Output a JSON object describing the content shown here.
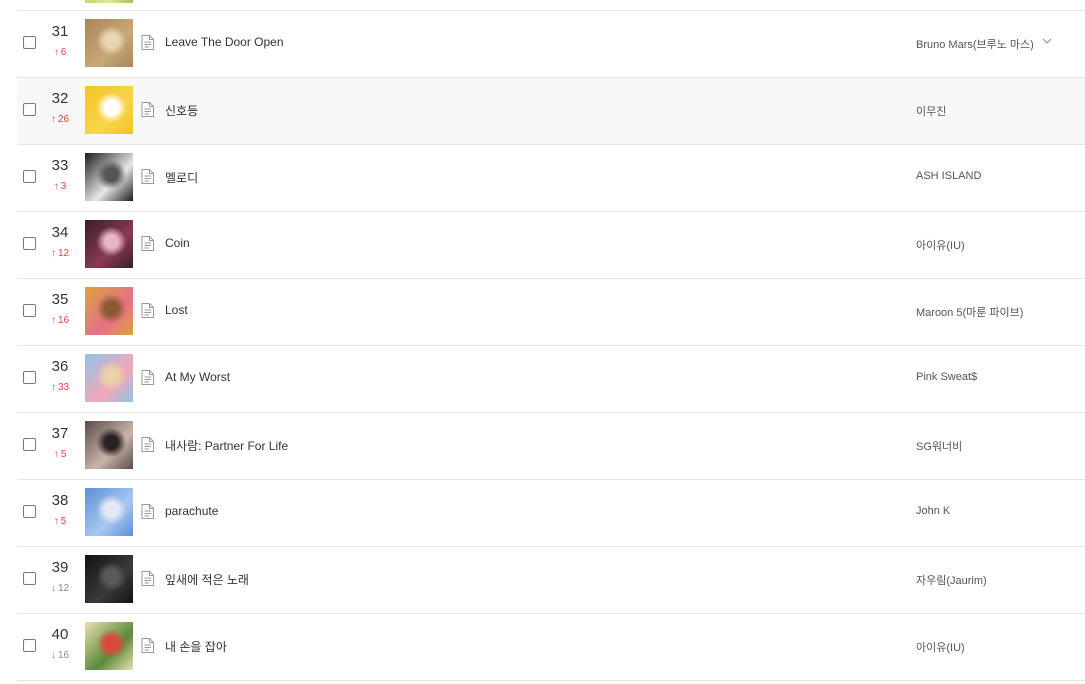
{
  "chart": {
    "rows": [
      {
        "rank": "31",
        "direction": "up",
        "change": "6",
        "title": "Leave The Door Open",
        "artist": "Bruno Mars(브루노 마스)",
        "art": [
          "#a98458",
          "#c9a877",
          "#e8d7b3"
        ],
        "has_menu": true,
        "highlighted": false
      },
      {
        "rank": "32",
        "direction": "up",
        "change": "26",
        "title": "신호등",
        "artist": "이무진",
        "art": [
          "#f2c326",
          "#f6d64a",
          "#ffffff"
        ],
        "has_menu": false,
        "highlighted": true
      },
      {
        "rank": "33",
        "direction": "up",
        "change": "3",
        "title": "멜로디",
        "artist": "ASH ISLAND",
        "art": [
          "#1b1b1b",
          "#e8e8e8",
          "#555555"
        ],
        "has_menu": false,
        "highlighted": false
      },
      {
        "rank": "34",
        "direction": "up",
        "change": "12",
        "title": "Coin",
        "artist": "아이유(IU)",
        "art": [
          "#3a1d2a",
          "#8a3a52",
          "#e6b6c2"
        ],
        "has_menu": false,
        "highlighted": false
      },
      {
        "rank": "35",
        "direction": "up",
        "change": "16",
        "title": "Lost",
        "artist": "Maroon 5(마룬 파이브)",
        "art": [
          "#d9a53a",
          "#e86e8a",
          "#8c5a32"
        ],
        "has_menu": false,
        "highlighted": false
      },
      {
        "rank": "36",
        "direction": "up",
        "change": "33",
        "title": "At My Worst",
        "artist": "Pink Sweat$",
        "art": [
          "#8fc4e8",
          "#f3a7b9",
          "#e9d1a8"
        ],
        "has_menu": false,
        "highlighted": false
      },
      {
        "rank": "37",
        "direction": "up",
        "change": "5",
        "title": "내사람: Partner For Life",
        "artist": "SG워너비",
        "art": [
          "#5a4a4a",
          "#c9b6a8",
          "#2a2222"
        ],
        "has_menu": false,
        "highlighted": false
      },
      {
        "rank": "38",
        "direction": "up",
        "change": "5",
        "title": "parachute",
        "artist": "John K",
        "art": [
          "#5c8fd6",
          "#a9c8ef",
          "#e3e9f7"
        ],
        "has_menu": false,
        "highlighted": false
      },
      {
        "rank": "39",
        "direction": "down",
        "change": "12",
        "title": "잎새에 적은 노래",
        "artist": "자우림(Jaurim)",
        "art": [
          "#121212",
          "#3a3a3a",
          "#5a5a5a"
        ],
        "has_menu": false,
        "highlighted": false
      },
      {
        "rank": "40",
        "direction": "down",
        "change": "16",
        "title": "내 손을 잡아",
        "artist": "아이유(IU)",
        "art": [
          "#e9e1b0",
          "#5a8a3a",
          "#d94a3a"
        ],
        "has_menu": false,
        "highlighted": false
      }
    ]
  },
  "colors": {
    "up": "#e8453c",
    "down": "#8a8a8a",
    "divider": "#e6e6e6",
    "hover": "#f8f8f8"
  },
  "icons": {
    "lyrics": "document-icon",
    "up": "arrow-up-icon",
    "down": "arrow-down-icon",
    "menu": "chevron-down-icon"
  }
}
